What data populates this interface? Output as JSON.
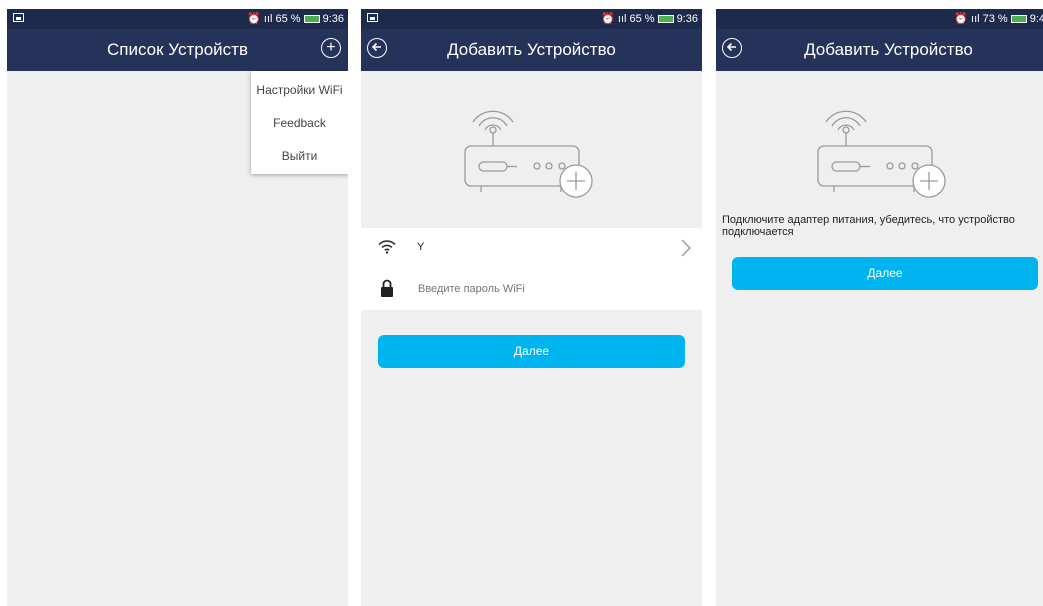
{
  "screen1": {
    "status": {
      "signal": "ııl 65 %",
      "time": "9:36"
    },
    "title": "Список Устройств",
    "menu": [
      "Настройки WiFi",
      "Feedback",
      "Выйти"
    ]
  },
  "screen2": {
    "status": {
      "signal": "ııl 65 %",
      "time": "9:36"
    },
    "title": "Добавить Устройство",
    "wifi_name": "Y",
    "password_placeholder": "Введите пароль WiFi",
    "next_label": "Далее"
  },
  "screen3": {
    "status": {
      "signal": "ııl 73 %",
      "time": "9:4"
    },
    "title": "Добавить Устройство",
    "hint": "Подключите адаптер питания, убедитесь, что устройство подключается",
    "next_label": "Далее"
  },
  "colors": {
    "header": "#253259",
    "statusbar": "#1e2a4b",
    "button": "#00b4ef",
    "background": "#efefef"
  }
}
